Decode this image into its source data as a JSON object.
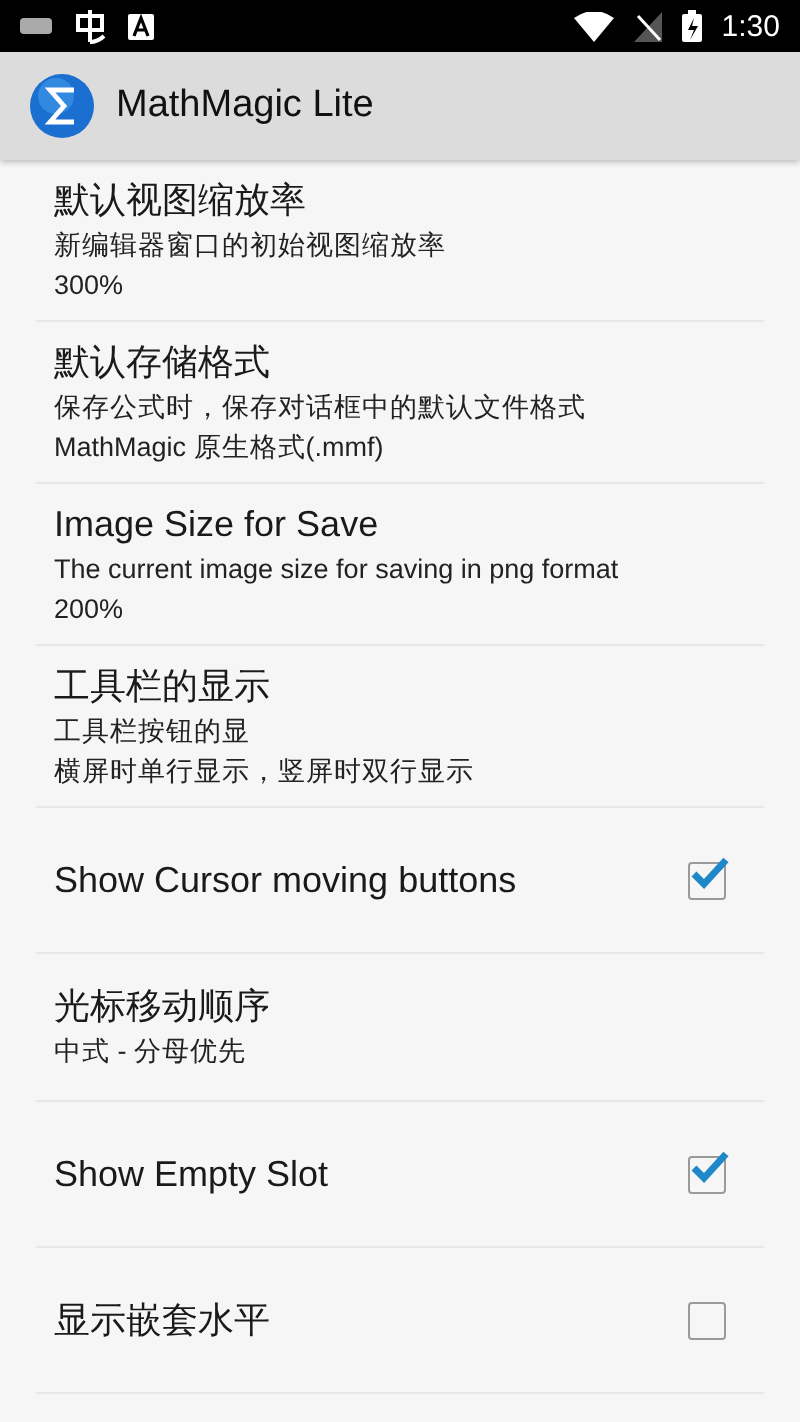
{
  "status_bar": {
    "time": "1:30"
  },
  "app_bar": {
    "title": "MathMagic Lite"
  },
  "settings": [
    {
      "kind": "text",
      "title": "默认视图缩放率",
      "summary": "新编辑器窗口的初始视图缩放率",
      "value": "300%"
    },
    {
      "kind": "text",
      "title": "默认存储格式",
      "summary": "保存公式时，保存对话框中的默认文件格式",
      "value": "MathMagic 原生格式(.mmf)"
    },
    {
      "kind": "text",
      "title": "Image Size for Save",
      "summary": "The current image size for saving in png format",
      "value": "200%"
    },
    {
      "kind": "text",
      "title": "工具栏的显示",
      "summary": "工具栏按钮的显",
      "value": "横屏时单行显示，竖屏时双行显示"
    },
    {
      "kind": "check",
      "title": "Show Cursor moving buttons",
      "checked": true
    },
    {
      "kind": "text",
      "title": "光标移动顺序",
      "summary": "中式 - 分母优先"
    },
    {
      "kind": "check",
      "title": "Show Empty Slot",
      "checked": true
    },
    {
      "kind": "check",
      "title": "显示嵌套水平",
      "checked": false
    }
  ]
}
